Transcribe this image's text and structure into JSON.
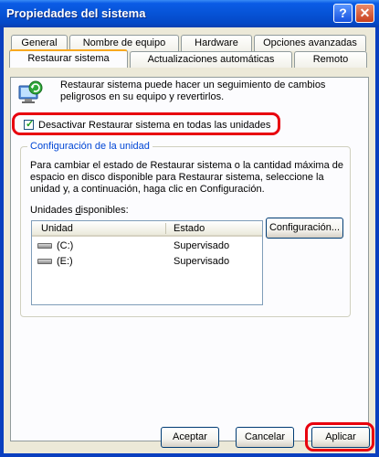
{
  "window": {
    "title": "Propiedades del sistema",
    "help_glyph": "?",
    "close_glyph": "✕"
  },
  "tabs": {
    "row1": [
      "General",
      "Nombre de equipo",
      "Hardware",
      "Opciones avanzadas"
    ],
    "row2": [
      "Restaurar sistema",
      "Actualizaciones automáticas",
      "Remoto"
    ],
    "active": "Restaurar sistema"
  },
  "description": "Restaurar sistema puede hacer un seguimiento de cambios peligrosos en su equipo y revertirlos.",
  "disable_checkbox": {
    "label": "Desactivar Restaurar sistema en todas las unidades",
    "checked": true,
    "check_glyph": "✓"
  },
  "group": {
    "title": "Configuración de la unidad",
    "text": "Para cambiar el estado de Restaurar sistema o la cantidad máxima de espacio en disco disponible para Restaurar sistema, seleccione la unidad y, a continuación, haga clic en Configuración.",
    "units_label": "Unidades disponibles:",
    "columns": {
      "unit": "Unidad",
      "status": "Estado"
    },
    "drives": [
      {
        "name": "(C:)",
        "status": "Supervisado",
        "icon": "hard-drive-icon"
      },
      {
        "name": "(E:)",
        "status": "Supervisado",
        "icon": "hard-drive-icon"
      }
    ],
    "config_button": "Configuración..."
  },
  "buttons": {
    "accept": "Aceptar",
    "cancel": "Cancelar",
    "apply": "Aplicar"
  },
  "colors": {
    "titlebar": "#0653d6",
    "highlight": "#e8000e",
    "group_title": "#0046d5",
    "face": "#ece9d8"
  }
}
